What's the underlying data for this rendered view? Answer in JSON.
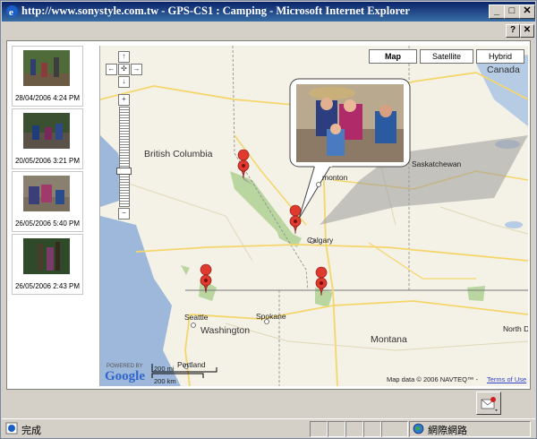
{
  "window": {
    "title": "http://www.sonystyle.com.tw - GPS-CS1 : Camping - Microsoft Internet Explorer",
    "minimize": "_",
    "maximize": "□",
    "close": "✕",
    "help": "?",
    "dialog_close": "✕"
  },
  "thumbnails": [
    {
      "date": "28/04/2006 4:24 PM"
    },
    {
      "date": "20/05/2006 3:21 PM"
    },
    {
      "date": "26/05/2006 5:40 PM"
    },
    {
      "date": "26/05/2006 2:43 PM"
    }
  ],
  "map": {
    "types": [
      "Map",
      "Satellite",
      "Hybrid"
    ],
    "active_type": "Map",
    "labels": {
      "canada": "Canada",
      "british_columbia": "British Columbia",
      "saskatchewan": "Saskatchewan",
      "edmonton": "monton",
      "calgary": "Calgary",
      "seattle": "Seattle",
      "washington": "Washington",
      "spokane": "Spokane",
      "montana": "Montana",
      "portland": "Portland",
      "north_d": "North D"
    },
    "scale": {
      "mi": "200 mi",
      "km": "200 km"
    },
    "powered_by": "POWERED BY",
    "google": "Google",
    "attribution": "Map data © 2006 NAVTEQ™ - ",
    "terms": "Terms of Use"
  },
  "status": {
    "text": "完成",
    "zone": "網際網路"
  }
}
